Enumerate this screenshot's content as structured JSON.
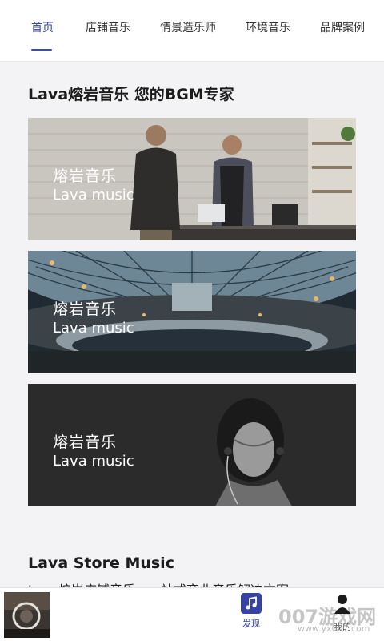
{
  "tabs": [
    {
      "label": "首页",
      "active": true
    },
    {
      "label": "店铺音乐",
      "active": false
    },
    {
      "label": "情景造乐师",
      "active": false
    },
    {
      "label": "环境音乐",
      "active": false
    },
    {
      "label": "品牌案例",
      "active": false
    }
  ],
  "main": {
    "title": "Lava熔岩音乐 您的BGM专家",
    "banners": [
      {
        "title_cn": "熔岩音乐",
        "title_en": "Lava music",
        "image": "cafe-counter-photo"
      },
      {
        "title_cn": "熔岩音乐",
        "title_en": "Lava music",
        "image": "glass-dome-mall-photo"
      },
      {
        "title_cn": "熔岩音乐",
        "title_en": "Lava music",
        "image": "woman-headphones-photo"
      }
    ],
    "store_section": {
      "title": "Lava Store Music",
      "description": "Lava熔岩店铺音乐，一站式商业音乐解决方案"
    }
  },
  "bottom_nav": {
    "player_thumb": "album-cover",
    "items": [
      {
        "label": "发现",
        "icon": "music-note-icon",
        "active": true
      },
      {
        "label": "我的",
        "icon": "user-icon",
        "active": false
      }
    ]
  },
  "watermark": {
    "text": "007游戏网",
    "url": "www.yx007.com"
  },
  "colors": {
    "accent": "#3b4ea3",
    "content_bg": "#f3f3f5"
  }
}
